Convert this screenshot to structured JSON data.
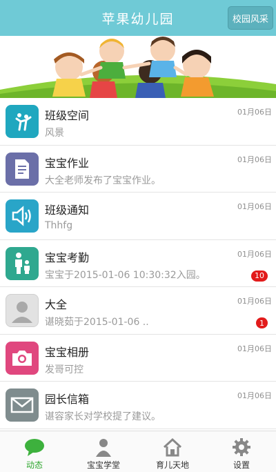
{
  "header": {
    "title": "苹果幼儿园",
    "right_button": "校园风采"
  },
  "list": [
    {
      "name": "班级空间",
      "sub": "风景",
      "date": "01月06日",
      "badge": "",
      "icon": "class-space-icon",
      "color": "#1fa7bf"
    },
    {
      "name": "宝宝作业",
      "sub": "大全老师发布了宝宝作业。",
      "date": "01月06日",
      "badge": "",
      "icon": "homework-document-icon",
      "color": "#6b6fa8"
    },
    {
      "name": "班级通知",
      "sub": "Thhfg",
      "date": "01月06日",
      "badge": "",
      "icon": "speaker-icon",
      "color": "#29a5c8"
    },
    {
      "name": "宝宝考勤",
      "sub": "宝宝于2015-01-06 10:30:32入园。",
      "date": "01月06日",
      "badge": "10",
      "icon": "attendance-family-icon",
      "color": "#2fa88f"
    },
    {
      "name": "大全",
      "sub": "谌晓茹于2015-01-06 ..",
      "date": "01月06日",
      "badge": "1",
      "icon": "user-avatar-icon",
      "color": "#d7d7d7"
    },
    {
      "name": "宝宝相册",
      "sub": "发哥可控",
      "date": "01月06日",
      "badge": "",
      "icon": "camera-icon",
      "color": "#e0477e"
    },
    {
      "name": "园长信箱",
      "sub": "谌容家长对学校提了建议。",
      "date": "01月06日",
      "badge": "",
      "icon": "mail-icon",
      "color": "#7f8c8e"
    }
  ],
  "tabs": [
    {
      "label": "动态",
      "icon": "chat-bubble-icon",
      "active": true
    },
    {
      "label": "宝宝学堂",
      "icon": "person-icon",
      "active": false
    },
    {
      "label": "育儿天地",
      "icon": "home-icon",
      "active": false
    },
    {
      "label": "设置",
      "icon": "gear-icon",
      "active": false
    }
  ],
  "colors": {
    "header": "#6fcad6",
    "active_tab": "#2ea62e",
    "badge": "#e21b1b"
  }
}
